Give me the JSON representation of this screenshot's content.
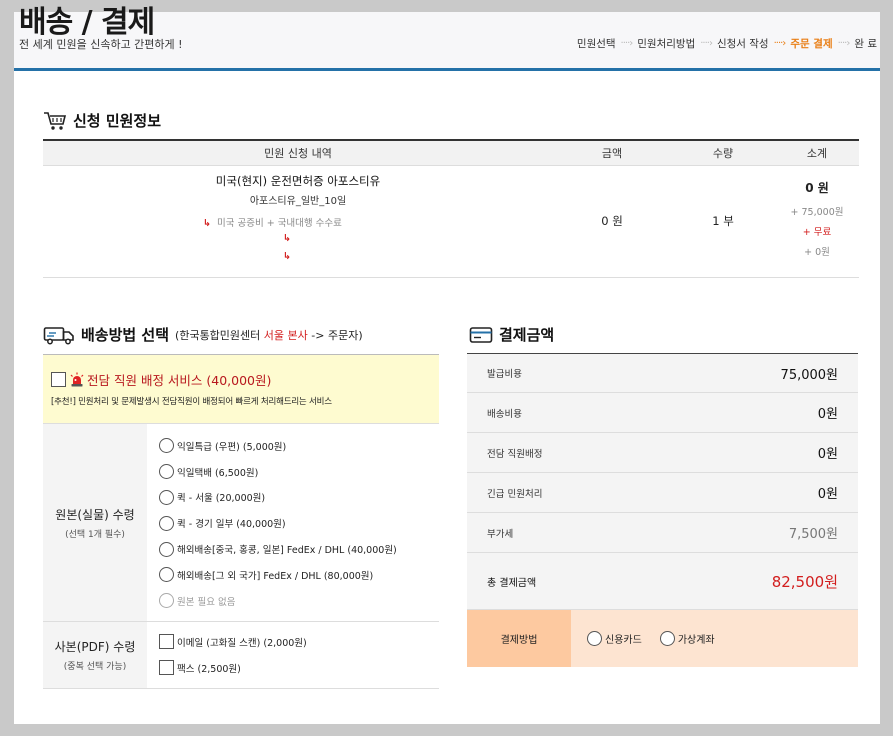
{
  "header": {
    "title": "배송 / 결제",
    "subtitle": "전 세계 민원을 신속하고 간편하게 !",
    "steps": [
      {
        "label": "민원선택",
        "active": false
      },
      {
        "label": "민원처리방법",
        "active": false
      },
      {
        "label": "신청서 작성",
        "active": false
      },
      {
        "label": "주문 결제",
        "active": true
      },
      {
        "label": "완 료",
        "active": false
      }
    ]
  },
  "applications": {
    "title": "신청 민원정보",
    "columns": [
      "민원 신청 내역",
      "금액",
      "수량",
      "소계"
    ],
    "rows": [
      {
        "name": "미국(현지) 운전면허증 아포스티유",
        "option": "아포스티유_일반_10일",
        "addons": [
          "미국 공증비 + 국내대행 수수료",
          "",
          ""
        ],
        "amount": "0 원",
        "quantity": "1 부",
        "subtotal": "0 원",
        "subtotal_lines": [
          "+ 75,000원",
          "+ 무료",
          "+ 0원"
        ]
      }
    ]
  },
  "delivery": {
    "title": "배송방법 선택",
    "note_prefix": "(한국통합민원센터",
    "note_highlight": "서울 본사",
    "note_suffix": "-> 주문자)",
    "premium_label": "전담 직원 배정 서비스 (40,000원)",
    "premium_desc": "[추천!] 민원처리 및 문제발생시 전담직원이 배정되어 빠르게 처리해드리는 서비스",
    "original": {
      "label": "원본(실물) 수령",
      "sub": "(선택 1개 필수)",
      "options": [
        "익일특급 (우편) (5,000원)",
        "익일택배 (6,500원)",
        "퀵 - 서울 (20,000원)",
        "퀵 - 경기 일부 (40,000원)",
        "해외배송[중국, 홍콩, 일본] FedEx / DHL (40,000원)",
        "해외배송[그 외 국가] FedEx / DHL (80,000원)",
        "원본 필요 없음"
      ]
    },
    "copy": {
      "label": "사본(PDF) 수령",
      "sub": "(중복 선택 가능)",
      "options": [
        "이메일 (고화질 스캔) (2,000원)",
        "팩스 (2,500원)"
      ]
    }
  },
  "payment": {
    "title": "결제금액",
    "rows": [
      {
        "label": "발급비용",
        "value": "75,000원"
      },
      {
        "label": "배송비용",
        "value": "0원"
      },
      {
        "label": "전담 직원배정",
        "value": "0원"
      },
      {
        "label": "긴급 민원처리",
        "value": "0원"
      },
      {
        "label": "부가세",
        "value": "7,500원"
      }
    ],
    "total_label": "총 결제금액",
    "total_value": "82,500원",
    "method_label": "결제방법",
    "methods": [
      "신용카드",
      "가상계좌"
    ]
  },
  "colors": {
    "accent_blue": "#2471a8",
    "active_step": "#e97f16",
    "red": "#d21d1d",
    "premium_bg": "#fefbd0",
    "method_label_bg": "#fdc9a0",
    "method_bg": "#fde4d1"
  },
  "icons": {
    "applications": "cart-icon",
    "delivery": "truck-icon",
    "payment": "card-icon",
    "premium": "siren-icon"
  }
}
